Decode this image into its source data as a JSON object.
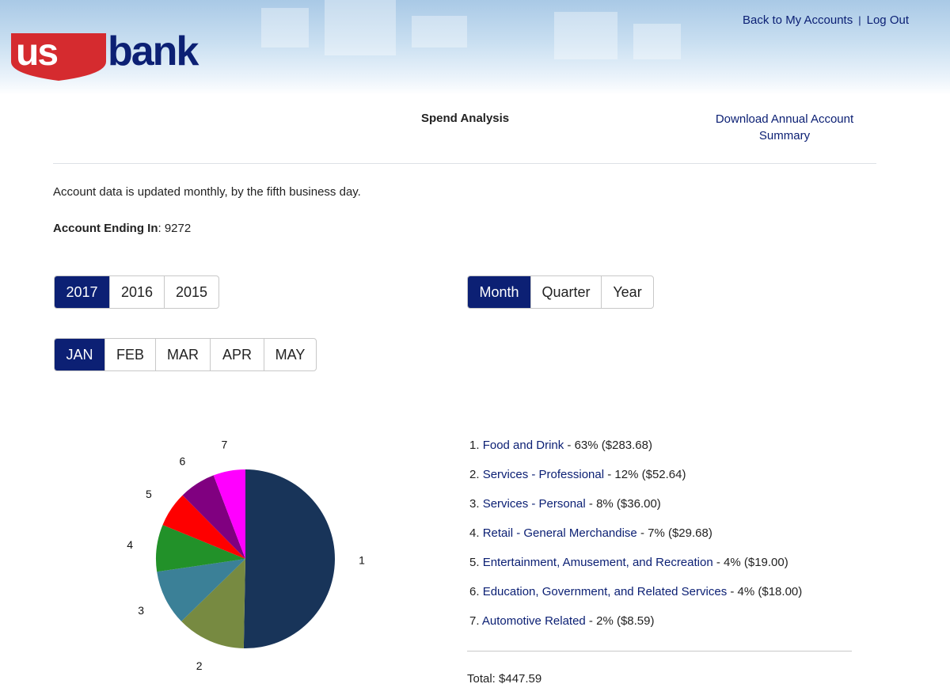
{
  "header": {
    "brand": "usbank",
    "links": [
      {
        "label": "Back to My Accounts"
      },
      {
        "label": "Log Out"
      }
    ],
    "separator": "|"
  },
  "page": {
    "title": "Spend Analysis",
    "download_label": "Download Annual Account Summary",
    "update_note": "Account data is updated monthly, by the fifth business day.",
    "account_label": "Account Ending In",
    "account_number": ": 9272"
  },
  "years": [
    {
      "label": "2017",
      "active": true
    },
    {
      "label": "2016",
      "active": false
    },
    {
      "label": "2015",
      "active": false
    }
  ],
  "periods": [
    {
      "label": "Month",
      "active": true
    },
    {
      "label": "Quarter",
      "active": false
    },
    {
      "label": "Year",
      "active": false
    }
  ],
  "months": [
    {
      "label": "JAN",
      "active": true
    },
    {
      "label": "FEB",
      "active": false
    },
    {
      "label": "MAR",
      "active": false
    },
    {
      "label": "APR",
      "active": false
    },
    {
      "label": "MAY",
      "active": false
    }
  ],
  "legend": [
    {
      "number": "1.",
      "category": "Food and Drink",
      "detail": " - 63% ($283.68)"
    },
    {
      "number": "2.",
      "category": "Services - Professional",
      "detail": " - 12% ($52.64)"
    },
    {
      "number": "3.",
      "category": "Services - Personal",
      "detail": " - 8% ($36.00)"
    },
    {
      "number": "4.",
      "category": "Retail - General Merchandise",
      "detail": " - 7% ($29.68)"
    },
    {
      "number": "5.",
      "category": "Entertainment, Amusement, and Recreation",
      "detail": " - 4% ($19.00)"
    },
    {
      "number": "6.",
      "category": "Education, Government, and Related Services",
      "detail": " - 4% ($18.00)"
    },
    {
      "number": "7.",
      "category": "Automotive Related",
      "detail": " - 2% ($8.59)"
    }
  ],
  "total": "Total: $447.59",
  "chart_data": {
    "type": "pie",
    "title": "",
    "slice_labels": [
      "1",
      "2",
      "3",
      "4",
      "5",
      "6",
      "7"
    ],
    "values": [
      50.3,
      12.4,
      10.0,
      8.5,
      6.4,
      6.6,
      5.8
    ],
    "colors": [
      "#183459",
      "#778a41",
      "#3b8097",
      "#229129",
      "#fe0000",
      "#800080",
      "#ff00ff"
    ],
    "start_angle": "12 o'clock, clockwise"
  }
}
